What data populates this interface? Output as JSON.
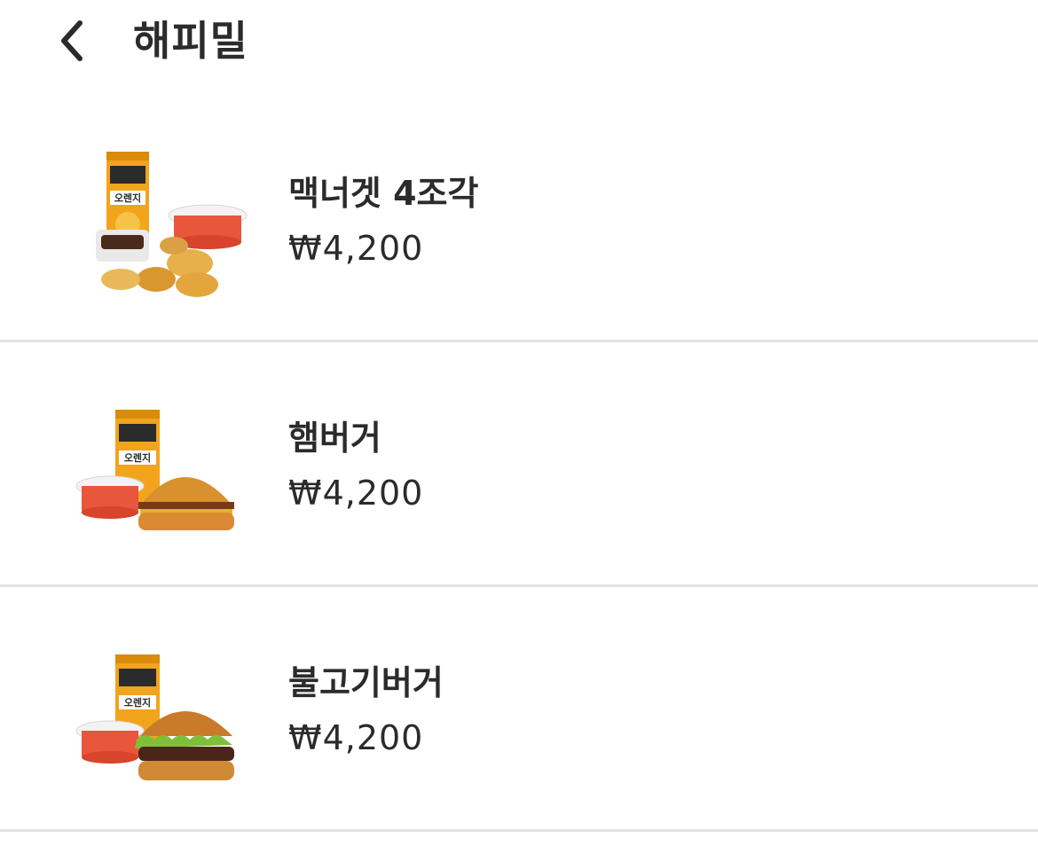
{
  "header": {
    "title": "해피밀",
    "back_icon": "chevron-left-icon"
  },
  "items": [
    {
      "name": "맥너겟 4조각",
      "price": "₩4,200",
      "drink_label": "오렌지"
    },
    {
      "name": "햄버거",
      "price": "₩4,200",
      "drink_label": "오렌지"
    },
    {
      "name": "불고기버거",
      "price": "₩4,200",
      "drink_label": "오렌지"
    }
  ]
}
